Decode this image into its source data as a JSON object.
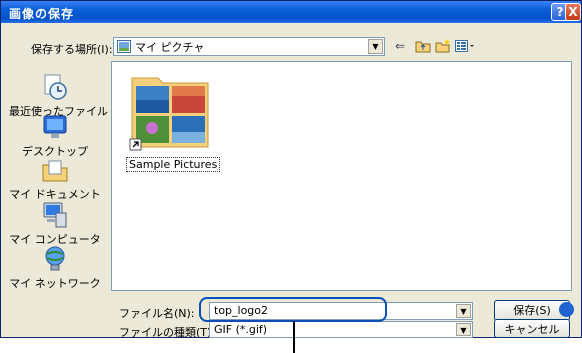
{
  "window": {
    "title": "画像の保存"
  },
  "titlebar_buttons": {
    "help": "?",
    "close": "X"
  },
  "location": {
    "label": "保存する場所(I):",
    "value": "マイ ピクチャ"
  },
  "sidebar": {
    "items": [
      {
        "label": "最近使ったファイル",
        "icon": "recent-files-icon"
      },
      {
        "label": "デスクトップ",
        "icon": "desktop-icon"
      },
      {
        "label": "マイ ドキュメント",
        "icon": "my-documents-icon"
      },
      {
        "label": "マイ コンピュータ",
        "icon": "my-computer-icon"
      },
      {
        "label": "マイ ネットワーク",
        "icon": "my-network-icon"
      }
    ]
  },
  "files": [
    {
      "name": "Sample Pictures",
      "icon": "folder-icon"
    }
  ],
  "filename": {
    "label": "ファイル名(N):",
    "value": "top_logo2"
  },
  "filetype": {
    "label": "ファイルの種類(T):",
    "value": "GIF (*.gif)"
  },
  "buttons": {
    "save": "保存(S)",
    "cancel": "キャンセル"
  },
  "colors": {
    "titlebar": "#0a5ed8",
    "highlight": "#0a4fb5",
    "dialog_bg": "#ece9d8"
  }
}
